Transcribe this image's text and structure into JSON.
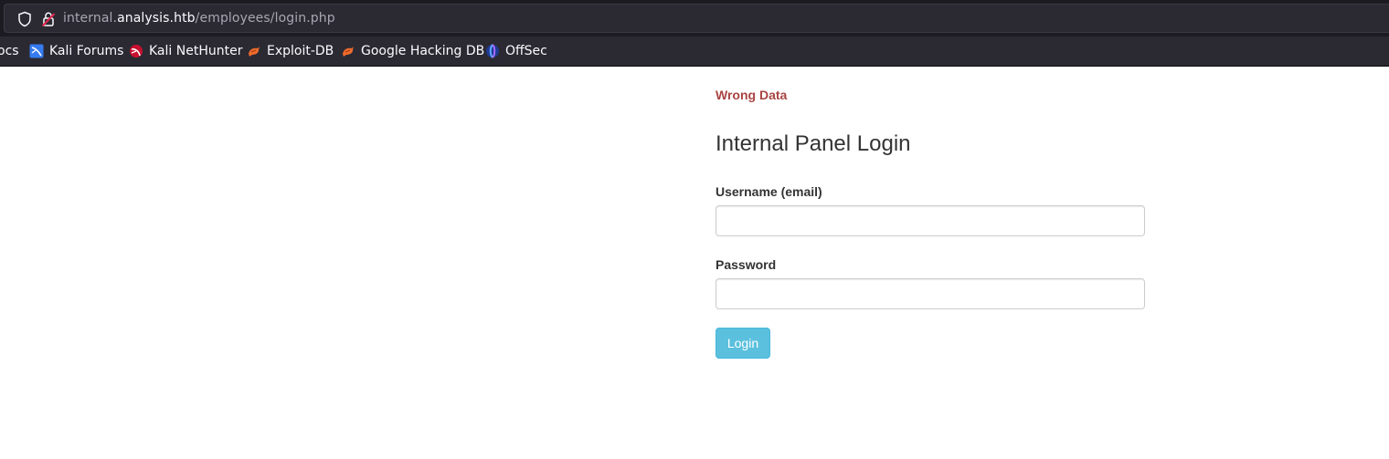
{
  "browser": {
    "url_prefix": "internal.",
    "url_host": "analysis.htb",
    "url_path": "/employees/login.php",
    "bookmarks": [
      {
        "label": "ocs",
        "icon": "docs-icon"
      },
      {
        "label": "Kali Forums",
        "icon": "kali-forums-icon"
      },
      {
        "label": "Kali NetHunter",
        "icon": "kali-nethunter-icon"
      },
      {
        "label": "Exploit-DB",
        "icon": "exploit-db-icon"
      },
      {
        "label": "Google Hacking DB",
        "icon": "google-hacking-db-icon"
      },
      {
        "label": "OffSec",
        "icon": "offsec-icon"
      }
    ]
  },
  "login": {
    "error": "Wrong Data",
    "title": "Internal Panel Login",
    "username_label": "Username (email)",
    "username_value": "",
    "password_label": "Password",
    "password_value": "",
    "submit_label": "Login"
  },
  "colors": {
    "error": "#a94442",
    "button": "#5bc0de",
    "chrome": "#2b2a33"
  }
}
